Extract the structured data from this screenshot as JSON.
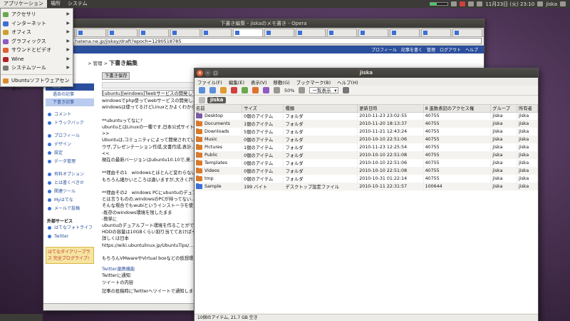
{
  "panel": {
    "menus": [
      "アプリケーション",
      "場所",
      "システム"
    ],
    "clock": "11月23日 (火) 23:10",
    "user": "jiska"
  },
  "appmenu": {
    "items": [
      {
        "label": "アクセサリ",
        "color": "#6aa84f"
      },
      {
        "label": "インターネット",
        "color": "#3a6fd8"
      },
      {
        "label": "オフィス",
        "color": "#c9a227"
      },
      {
        "label": "グラフィックス",
        "color": "#8e5bc4"
      },
      {
        "label": "サウンドとビデオ",
        "color": "#e06030"
      },
      {
        "label": "Wine",
        "color": "#b22222"
      },
      {
        "label": "システムツール",
        "color": "#7a7a7a"
      }
    ],
    "footer": {
      "label": "Ubuntuソフトウェアセンター",
      "color": "#d98b2b"
    }
  },
  "browser": {
    "title": "下書き編集 - jiskaのメモ書き - Opera",
    "url": "http://d.hatena.ne.jp/jiskay/draft?epoch=1290518785",
    "hatena_links": [
      "プロフィール",
      "記事を書く",
      "管理",
      "ログアウト",
      "ヘルプ"
    ],
    "crumbs": "> 管理 > ",
    "crumb_current": "下書き編集",
    "side": {
      "head": "記事",
      "subs": [
        "過去の記事",
        "下書き記事"
      ],
      "group1": [
        "コメント",
        "トラックバック"
      ],
      "group2": [
        "プロフィール",
        "デザイン",
        "設定",
        "データ管理"
      ],
      "group3": [
        "有料オプション",
        "とは書くべきか",
        "関連ツール",
        "Myはてな",
        "メールで投稿"
      ],
      "ext_title": "外部サービス",
      "ext": [
        "はてなフォトライフ",
        "Twitter"
      ],
      "banner": "はてなダイアリープラス 完全プログライブ!"
    },
    "editor": {
      "save": "下書き保存",
      "title_value": "[ubuntu][windows]Twebサービスの開発している...",
      "lines": [
        "windowsでphp使ってwebサービスの開発し...",
        "windowsは使ってるけどLinuxとかよくわから...",
        "",
        "**ubuntuってなに?",
        "ubuntuとはLinuxの一種です,日本公式サイト...",
        ">>",
        "Ubuntuは,コミュニティによって開発されてい...",
        "ウザ,プレゼンテーション作成,文書作成,表計...",
        "<<",
        "現在の最新バージョンはubuntu10.10で,来...",
        "",
        "**理由その1　windowsとほとんど変わらない...",
        "もちろん細かいところは違いますが,大きく戸惑...",
        "",
        "**理由その2　windows PCにubuntuのデュア...",
        "とは言うものの,windowsのPCが持ってない...",
        "そんな場合でもwubiというインストーラを使えば...",
        "-既存のwindows環境を残したまま",
        "-簡単に",
        "ubuntuのデュアルブート環境を作ることができま...",
        "HDDの容量は10GBくらい割り当てておけば十分...",
        "詳しくは日本",
        "https://wiki.ubuntulinux.jp/UbuntuTips/...",
        "",
        "もちろんVMwareやVirtual boxなどの仮想環..."
      ],
      "twitter_head": "Twitter連携機能",
      "twitter_notify": "Twitterに通知",
      "tweet_label": "ツイートの内容",
      "footer_note": "記事の投稿時にTwitterへツイートで通知します。"
    }
  },
  "filemanager": {
    "title": "jiska",
    "menus": [
      "ファイル(F)",
      "編集(E)",
      "表示(V)",
      "移動(G)",
      "ブックマーク(B)",
      "ヘルプ(H)"
    ],
    "zoom": "50%",
    "view_mode": "一覧表示",
    "location": "jiska",
    "columns": [
      "名前",
      "サイズ",
      "種類",
      "更新日時",
      "8 進数表記のアクセス権",
      "グループ",
      "所有者"
    ],
    "rows": [
      {
        "name": "Desktop",
        "size": "0個のアイテム",
        "type": "フォルダ",
        "date": "2010-11-23 23:02:55",
        "perm": "40755",
        "group": "jiska",
        "owner": "jiska",
        "color": "#7b5aa6"
      },
      {
        "name": "Documents",
        "size": "1個のアイテム",
        "type": "フォルダ",
        "date": "2010-11-20 18:13:37",
        "perm": "40755",
        "group": "jiska",
        "owner": "jiska",
        "color": "#d9792b"
      },
      {
        "name": "Downloads",
        "size": "5個のアイテム",
        "type": "フォルダ",
        "date": "2010-11-21 12:43:24",
        "perm": "40755",
        "group": "jiska",
        "owner": "jiska",
        "color": "#d9792b"
      },
      {
        "name": "Music",
        "size": "0個のアイテム",
        "type": "フォルダ",
        "date": "2010-10-10 22:51:06",
        "perm": "40755",
        "group": "jiska",
        "owner": "jiska",
        "color": "#d9792b"
      },
      {
        "name": "Pictures",
        "size": "1個のアイテム",
        "type": "フォルダ",
        "date": "2010-11-23 12:25:54",
        "perm": "40755",
        "group": "jiska",
        "owner": "jiska",
        "color": "#d9792b"
      },
      {
        "name": "Public",
        "size": "0個のアイテム",
        "type": "フォルダ",
        "date": "2010-10-10 22:51:08",
        "perm": "40755",
        "group": "jiska",
        "owner": "jiska",
        "color": "#d9792b"
      },
      {
        "name": "Templates",
        "size": "0個のアイテム",
        "type": "フォルダ",
        "date": "2010-10-10 22:51:06",
        "perm": "40755",
        "group": "jiska",
        "owner": "jiska",
        "color": "#d9792b"
      },
      {
        "name": "Videos",
        "size": "0個のアイテム",
        "type": "フォルダ",
        "date": "2010-10-10 22:51:08",
        "perm": "40755",
        "group": "jiska",
        "owner": "jiska",
        "color": "#d9792b"
      },
      {
        "name": "tmp",
        "size": "0個のアイテム",
        "type": "フォルダ",
        "date": "2010-10-31 01:22:14",
        "perm": "40755",
        "group": "jiska",
        "owner": "jiska",
        "color": "#d9792b"
      },
      {
        "name": "Sample",
        "size": "199 バイト",
        "type": "デスクトップ設定ファイル",
        "date": "2010-10-11 22:31:57",
        "perm": "100644",
        "group": "jiska",
        "owner": "jiska",
        "color": "#3a6fd8"
      }
    ],
    "status": "10個のアイテム, 21.7 GB 空き"
  }
}
